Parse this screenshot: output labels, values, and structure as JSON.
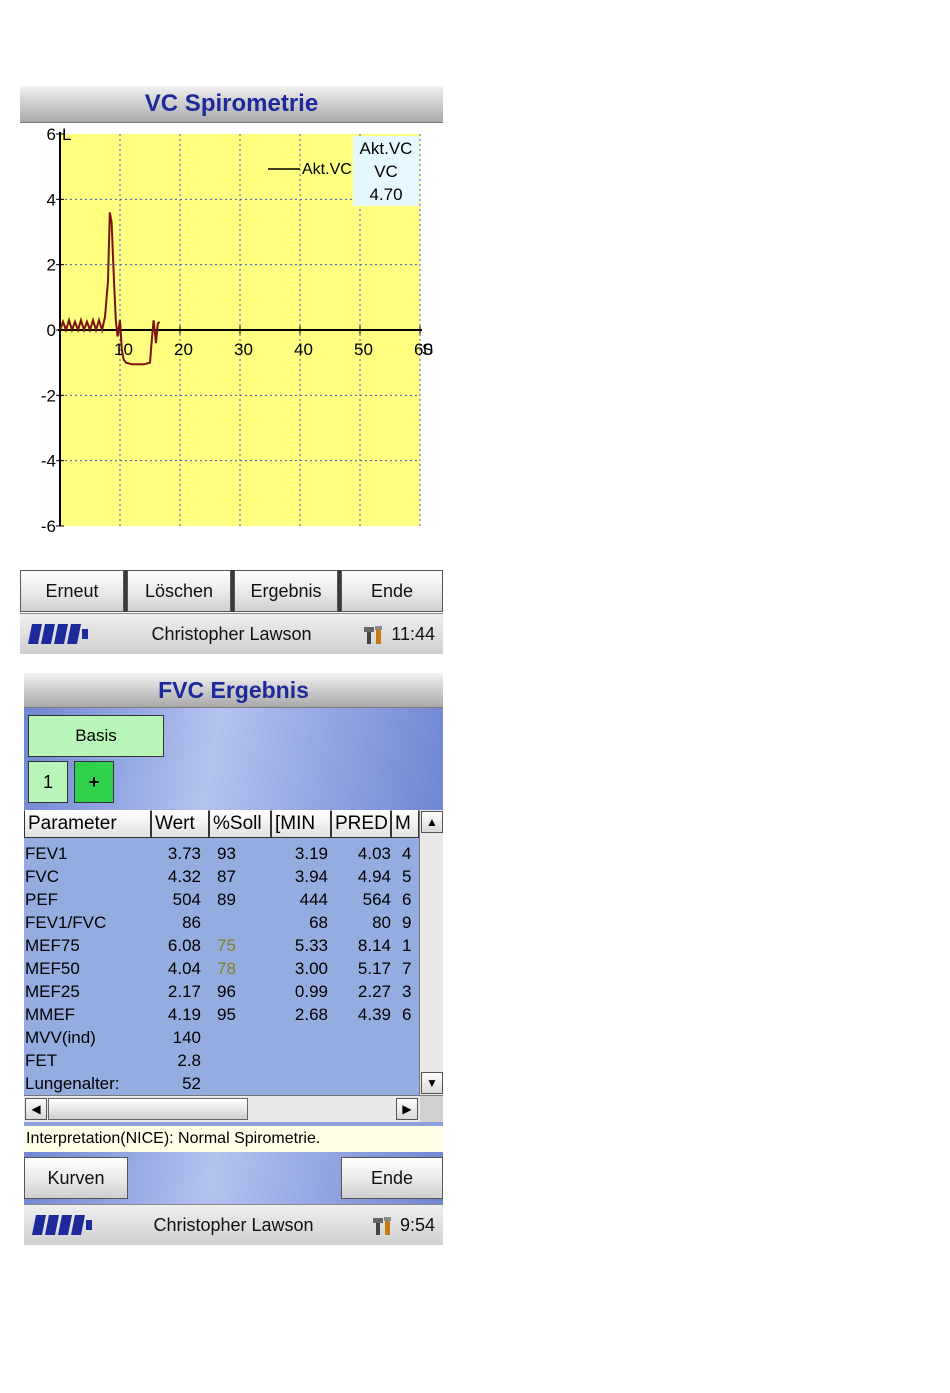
{
  "vc_screen": {
    "title": "VC Spirometrie",
    "legend_series": "Akt.VC",
    "info_box": {
      "line1": "Akt.VC",
      "line2": "VC",
      "line3": "4.70"
    },
    "buttons": {
      "retry": "Erneut",
      "delete": "Löschen",
      "result": "Ergebnis",
      "end": "Ende"
    },
    "status": {
      "user": "Christopher Lawson",
      "time": "11:44"
    }
  },
  "chart_data": {
    "type": "line",
    "xlim": [
      0,
      60
    ],
    "ylim": [
      -6,
      6
    ],
    "x_ticks": [
      "10",
      "20",
      "30",
      "40",
      "50",
      "60"
    ],
    "y_ticks": [
      "6",
      "4",
      "2",
      "0",
      "-2",
      "-4",
      "-6"
    ],
    "x_unit": "S",
    "y_unit": "L",
    "grid": true,
    "legend": "top-right",
    "colors": {
      "plot_bg": "#ffff80",
      "grid": "#4a56d8",
      "line": "#7a1010"
    },
    "series": [
      {
        "name": "Akt.VC",
        "x": [
          0,
          0.5,
          1,
          1.5,
          2,
          2.5,
          3,
          3.5,
          4,
          4.5,
          5,
          5.5,
          6,
          6.5,
          7,
          7.5,
          8,
          8.3,
          8.6,
          9,
          9.3,
          9.6,
          10,
          10.3,
          10.6,
          11,
          12,
          13,
          14,
          15,
          15.3,
          15.6,
          16,
          16.3,
          16.6
        ],
        "y": [
          0,
          0.25,
          0,
          0.3,
          0,
          0.25,
          0,
          0.3,
          0,
          0.25,
          0,
          0.3,
          0,
          0.3,
          0,
          0.4,
          1.5,
          3.6,
          3.3,
          1.5,
          0.3,
          -0.2,
          0.3,
          -0.6,
          -0.9,
          -1.0,
          -1.05,
          -1.05,
          -1.05,
          -1.0,
          -0.3,
          0.3,
          -0.4,
          0.2,
          0.25
        ]
      }
    ]
  },
  "fvc_screen": {
    "title": "FVC Ergebnis",
    "basis_label": "Basis",
    "index_label": "1",
    "add_label": "+",
    "columns": [
      "Parameter",
      "Wert",
      "%Soll",
      "[MIN",
      "PRED",
      "M"
    ],
    "rows": [
      [
        "FEV1",
        "3.73",
        "93",
        "3.19",
        "4.03",
        "4"
      ],
      [
        "FVC",
        "4.32",
        "87",
        "3.94",
        "4.94",
        "5"
      ],
      [
        "PEF",
        "504",
        "89",
        "444",
        "564",
        "6"
      ],
      [
        "FEV1/FVC",
        "86",
        "",
        "68",
        "80",
        "9"
      ],
      [
        "MEF75",
        "6.08",
        "75",
        "5.33",
        "8.14",
        "1"
      ],
      [
        "MEF50",
        "4.04",
        "78",
        "3.00",
        "5.17",
        "7"
      ],
      [
        "MEF25",
        "2.17",
        "96",
        "0.99",
        "2.27",
        "3"
      ],
      [
        "MMEF",
        "4.19",
        "95",
        "2.68",
        "4.39",
        "6"
      ],
      [
        "MVV(ind)",
        "140",
        "",
        "",
        "",
        ""
      ],
      [
        "FET",
        "2.8",
        "",
        "",
        "",
        ""
      ],
      [
        "Lungenalter:",
        "52",
        "",
        "",
        "",
        ""
      ]
    ],
    "low_percent_color": "#808020",
    "interpretation": "Interpretation(NICE): Normal Spirometrie.",
    "buttons": {
      "curves": "Kurven",
      "end": "Ende"
    },
    "status": {
      "user": "Christopher Lawson",
      "time": "9:54"
    }
  }
}
